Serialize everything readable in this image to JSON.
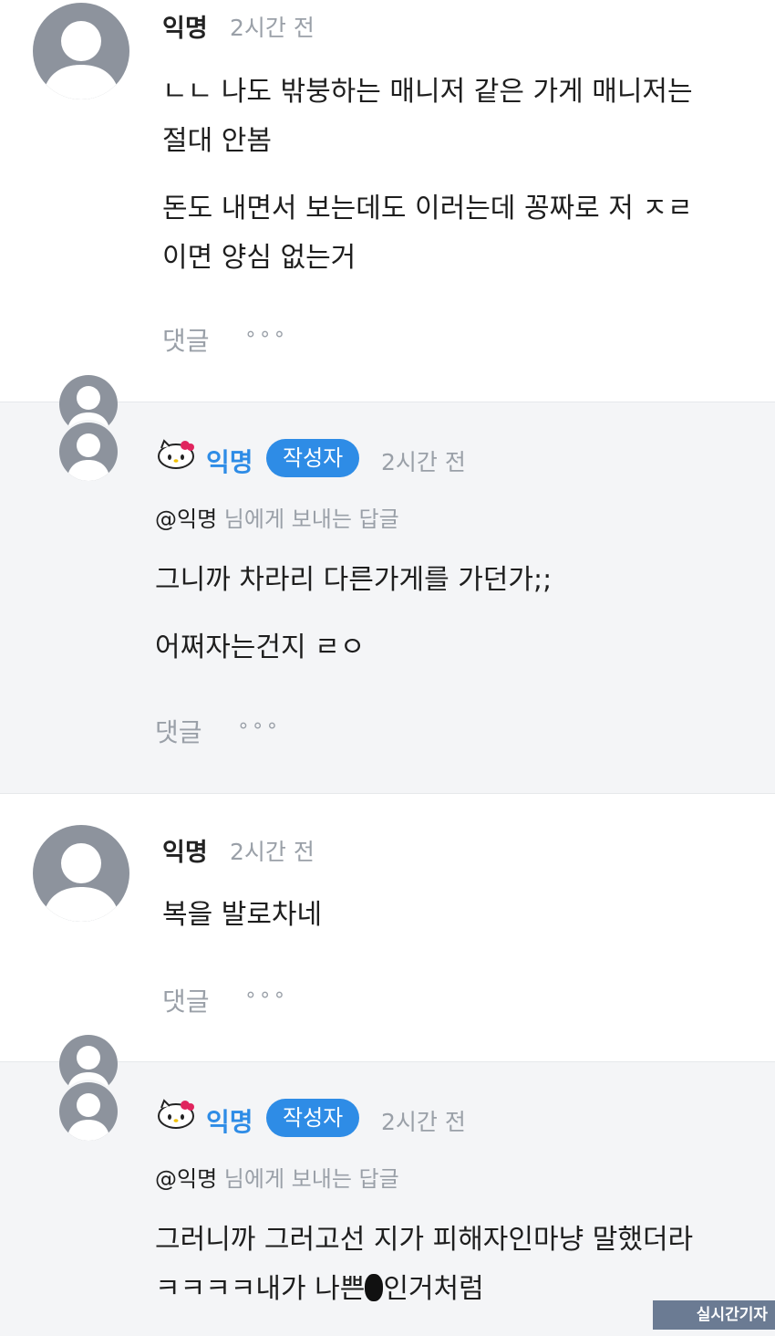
{
  "comments": [
    {
      "name": "익명",
      "time": "2시간 전",
      "lines": [
        "ㄴㄴ 나도 밖붕하는 매니저 같은 가게 매니저는",
        "절대 안봄",
        "돈도 내면서 보는데도 이러는데 꽁짜로 저 ㅈㄹ",
        "이면 양심 없는거"
      ],
      "reply_label": "댓글",
      "more_label": "∘∘∘"
    },
    {
      "name": "익명",
      "author_badge": "작성자",
      "time": "2시간 전",
      "mention_user": "@익명",
      "mention_rest": " 님에게 보내는 답글",
      "lines": [
        "그니까 차라리 다른가게를 가던가;;",
        "어쩌자는건지 ㄹㅇ"
      ],
      "reply_label": "댓글",
      "more_label": "∘∘∘"
    },
    {
      "name": "익명",
      "time": "2시간 전",
      "lines": [
        "복을 발로차네"
      ],
      "reply_label": "댓글",
      "more_label": "∘∘∘"
    },
    {
      "name": "익명",
      "author_badge": "작성자",
      "time": "2시간 전",
      "mention_user": "@익명",
      "mention_rest": " 님에게 보내는 답글",
      "lines": [
        "그러니까 그러고선 지가 피해자인마냥 말했더라",
        "ㅋㅋㅋㅋ내가 나쁜",
        "인거처럼"
      ]
    }
  ],
  "watermark": "실시간기자",
  "colors": {
    "accent": "#2e8ce6",
    "avatar": "#8d939d",
    "reply_bg": "#f4f5f7",
    "muted": "#9aa0a8"
  },
  "icons": {
    "avatar": "person-silhouette-icon",
    "kitty": "hello-kitty-icon",
    "more": "more-dots-icon"
  }
}
